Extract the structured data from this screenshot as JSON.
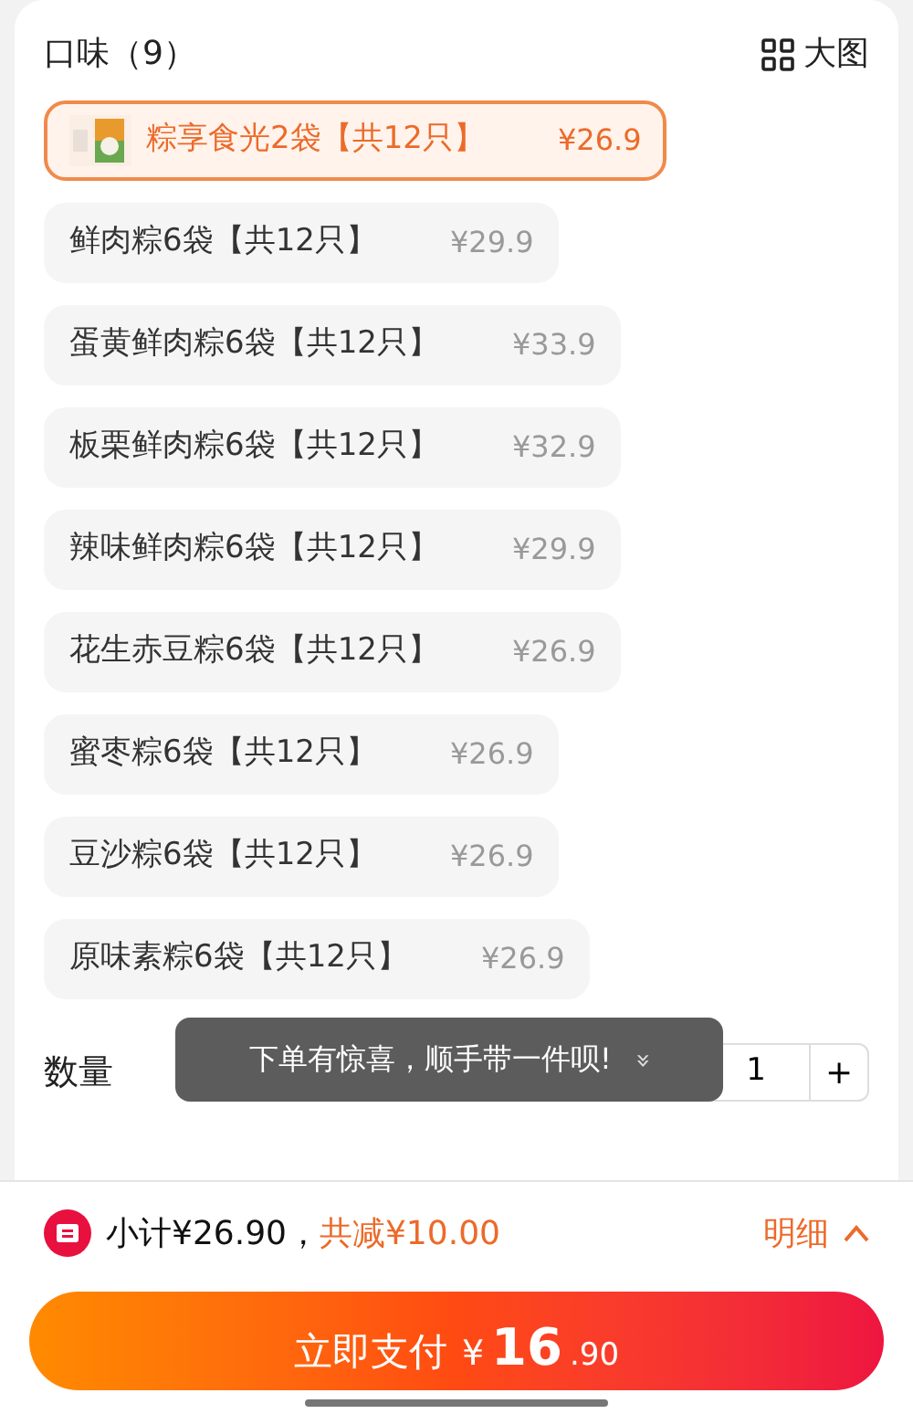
{
  "section": {
    "title": "口味（9）",
    "view_toggle": "大图"
  },
  "options": [
    {
      "name": "粽享食光2袋【共12只】",
      "price": "¥26.9",
      "selected": true,
      "has_thumbnail": true
    },
    {
      "name": "鲜肉粽6袋【共12只】",
      "price": "¥29.9",
      "selected": false,
      "has_thumbnail": false
    },
    {
      "name": "蛋黄鲜肉粽6袋【共12只】",
      "price": "¥33.9",
      "selected": false,
      "has_thumbnail": false
    },
    {
      "name": "板栗鲜肉粽6袋【共12只】",
      "price": "¥32.9",
      "selected": false,
      "has_thumbnail": false
    },
    {
      "name": "辣味鲜肉粽6袋【共12只】",
      "price": "¥29.9",
      "selected": false,
      "has_thumbnail": false
    },
    {
      "name": "花生赤豆粽6袋【共12只】",
      "price": "¥26.9",
      "selected": false,
      "has_thumbnail": false
    },
    {
      "name": "蜜枣粽6袋【共12只】",
      "price": "¥26.9",
      "selected": false,
      "has_thumbnail": false
    },
    {
      "name": "豆沙粽6袋【共12只】",
      "price": "¥26.9",
      "selected": false,
      "has_thumbnail": false
    },
    {
      "name": "原味素粽6袋【共12只】",
      "price": "¥26.9",
      "selected": false,
      "has_thumbnail": false
    }
  ],
  "quantity": {
    "label": "数量",
    "value": "1",
    "increment": "+"
  },
  "toast": {
    "text": "下单有惊喜，顺手带一件呗!",
    "icon": "»"
  },
  "summary": {
    "subtotal": "小计¥26.90，",
    "discount": "共减¥10.00",
    "details": "明细"
  },
  "pay_button": {
    "label": "立即支付",
    "currency": "¥",
    "amount_main": "16",
    "amount_decimal": ".90"
  }
}
